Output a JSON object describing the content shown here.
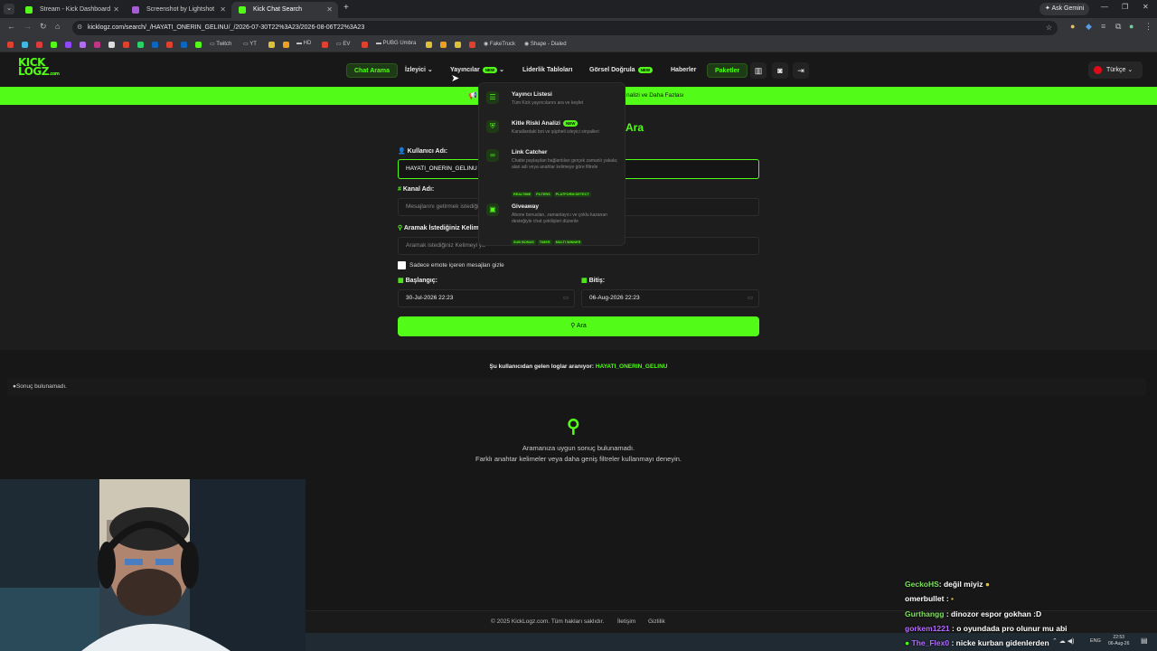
{
  "browser": {
    "tabs": [
      {
        "title": "Stream - Kick Dashboard",
        "color": "#53fc18"
      },
      {
        "title": "Screenshot by Lightshot",
        "color": "#a55cd6"
      },
      {
        "title": "Kick Chat Search",
        "color": "#53fc18"
      }
    ],
    "new_tab": "+",
    "ask_gemini": "Ask Gemini",
    "url": "kicklogz.com/search/_/HAYATI_ONERIN_GELINU/_/2026-07-30T22%3A23/2026-08-06T22%3A23",
    "bookmarks": [
      "Twitch",
      "YT",
      "HD",
      "EV",
      "PUBG Umbra",
      "FakeTruck",
      "Shape - Dialed"
    ]
  },
  "site": {
    "logo_line1": "KICK",
    "logo_line2": "LOGZ",
    "logo_suffix": ".com",
    "nav": {
      "chat_search": "Chat Arama",
      "viewer": "İzleyici",
      "streamers": "Yayıncılar",
      "new_badge": "NEW",
      "leaderboards": "Liderlik Tabloları",
      "visual_verify": "Görsel Doğrula",
      "news": "Haberler",
      "packages": "Paketler",
      "language": "Türkçe"
    },
    "banner_text": "nalizi ve Daha Fazlası",
    "heading_fragment": "Ara"
  },
  "dropdown": {
    "items": [
      {
        "title": "Yayıncı Listesi",
        "desc": "Tüm Kick yayıncılarını ara ve keşfet",
        "icon": "list-icon"
      },
      {
        "title": "Kitle Riski Analizi",
        "badge": "NEW",
        "desc": "Kanallardaki bot ve şüpheli izleyici sinyalleri",
        "icon": "shield-icon"
      },
      {
        "title": "Link Catcher",
        "desc": "Chatte paylaşılan bağlantıları gerçek zamanlı yakala; alan adı veya anahtar kelimeye göre filtrele",
        "tags": [
          "REALTIME",
          "FILTERS",
          "PLATFORM DETECT"
        ],
        "icon": "link-icon"
      },
      {
        "title": "Giveaway",
        "desc": "Abone bonusları, zamanlayıcı ve çoklu kazanan desteğiyle chat çekilişleri düzenle",
        "tags": [
          "SUB BONUS",
          "TIMER",
          "MULTI WINNER"
        ],
        "icon": "gift-icon"
      }
    ]
  },
  "form": {
    "username_label": "Kullanıcı Adı:",
    "username_value": "HAYATI_ONERIN_GELINU",
    "channel_label": "Kanal Adı:",
    "channel_placeholder": "Mesajlarını getirmek istediği",
    "keyword_label": "Aramak İstediğiniz Kelim",
    "keyword_placeholder": "Aramak istediğiniz Kelimeyi ya",
    "emote_checkbox_label": "Sadece emote içeren mesajları gizle",
    "emote_checkbox_checked": false,
    "start_label": "Başlangıç:",
    "start_value": "30-Jul-2026 22:23",
    "end_label": "Bitiş:",
    "end_value": "06-Aug-2026 22:23",
    "search_button": "Ara"
  },
  "results": {
    "searching_prefix": "Şu kullanıcıdan gelen loglar aranıyor:",
    "searching_user": "HAYATI_ONERIN_GELINU",
    "no_result_small": "Sonuç bulunamadı.",
    "empty_title": "Aramanıza uygun sonuç bulunamadı.",
    "empty_hint": "Farklı anahtar kelimeler veya daha geniş filtreler kullanmayı deneyin."
  },
  "footer": {
    "copyright": "© 2025 KickLogz.com. Tüm hakları saklıdır.",
    "contact": "İletişim",
    "privacy": "Gizlilik"
  },
  "chat_overlay": [
    {
      "user": "GeckoHS",
      "msg": ": değil miyiz",
      "color": "#7be35a"
    },
    {
      "user": "omerbullet",
      "msg": ":",
      "color": "#ffffff"
    },
    {
      "user": "Gurthangg",
      "msg": ": dinozor espor gokhan :D",
      "color": "#7be35a"
    },
    {
      "user": "gorkem1221",
      "msg": ": o oyundada pro olunur mu abi",
      "color": "#b36bff"
    },
    {
      "user": "The_Flex0",
      "msg": ": nicke kurban gidenlerden",
      "color": "#b36bff"
    }
  ],
  "taskbar": {
    "lang": "ENG",
    "time": "22:53",
    "date": "06-Aug-26"
  },
  "colors": {
    "accent": "#53fc18",
    "background": "#1d1d1d"
  }
}
